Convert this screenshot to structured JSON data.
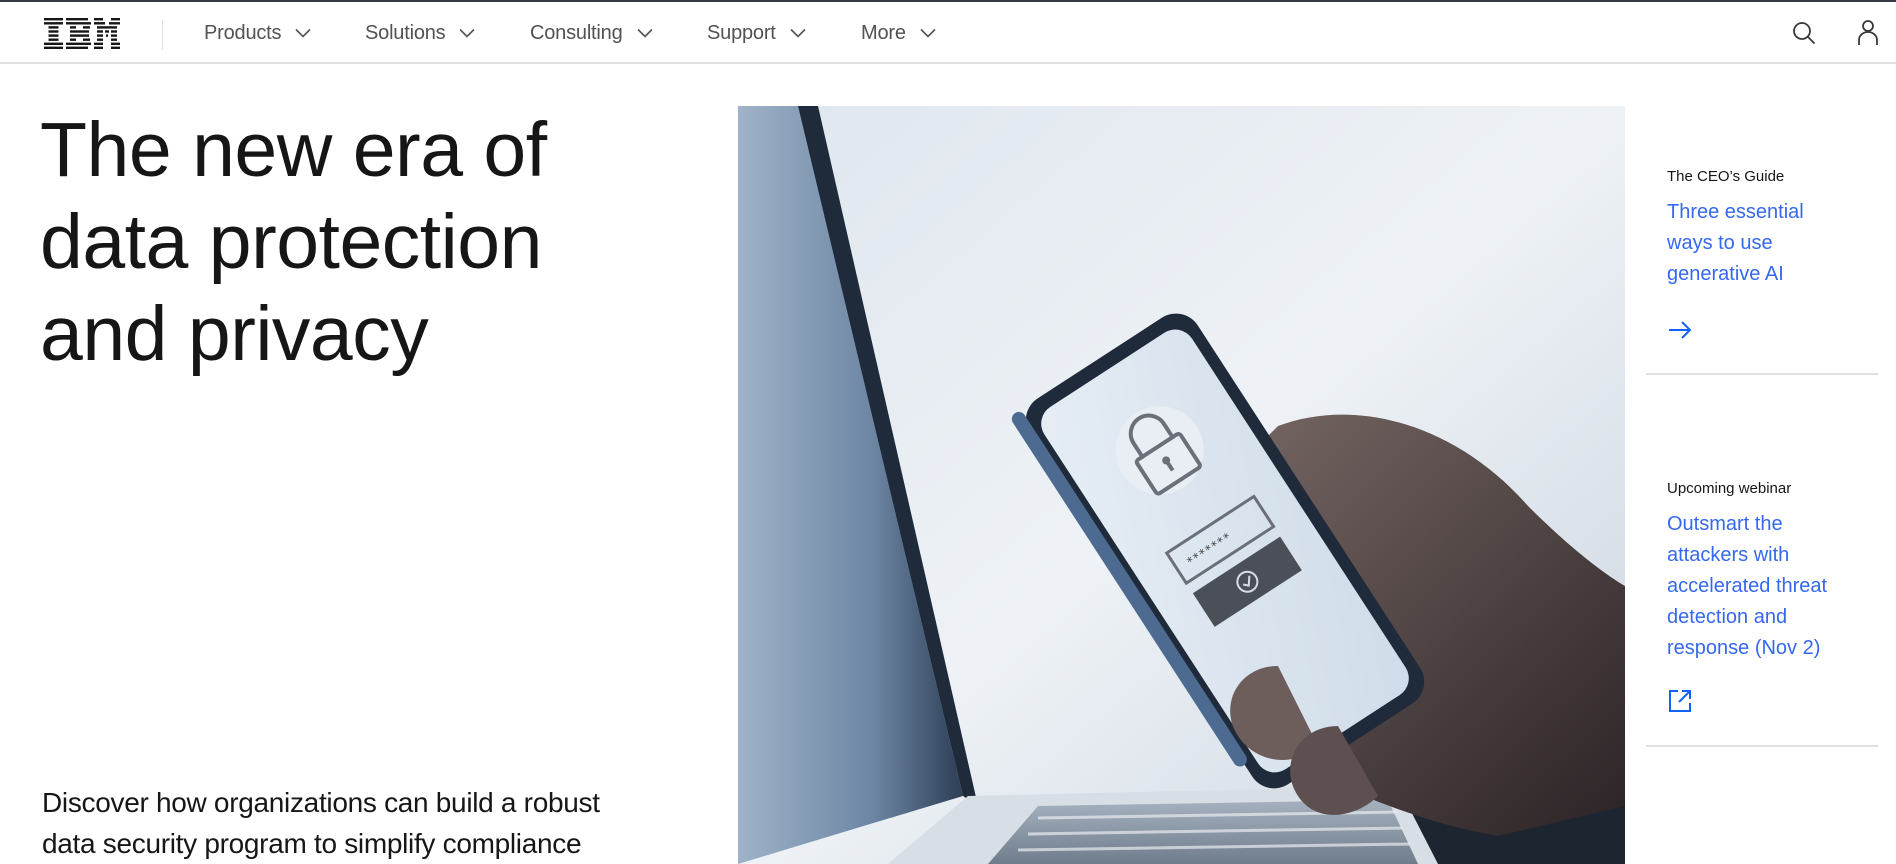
{
  "masthead": {
    "logo_alt": "IBM",
    "nav_items": [
      {
        "label": "Products",
        "icon": "chevron-down-icon"
      },
      {
        "label": "Solutions",
        "icon": "chevron-down-icon"
      },
      {
        "label": "Consulting",
        "icon": "chevron-down-icon"
      },
      {
        "label": "Support",
        "icon": "chevron-down-icon"
      },
      {
        "label": "More",
        "icon": "chevron-down-icon"
      }
    ],
    "actions": [
      {
        "name": "search",
        "icon": "search-icon"
      },
      {
        "name": "profile",
        "icon": "user-icon"
      }
    ]
  },
  "hero": {
    "headline_lines": [
      "The new era of",
      "data protection",
      "and privacy"
    ],
    "lede_lines": [
      "Discover how organizations can build a robust",
      "data security program to simplify compliance"
    ],
    "image_description": "Hand holding a smartphone showing a padlock and password login screen above a laptop keyboard"
  },
  "cards": [
    {
      "label": "The CEO’s Guide",
      "link_lines": [
        "Three essential",
        "ways to use",
        "generative AI"
      ],
      "icon": "arrow-right-icon"
    },
    {
      "label": "Upcoming webinar",
      "link_lines": [
        "Outsmart the",
        "attackers with",
        "accelerated threat",
        "detection and",
        "response (Nov 2)"
      ],
      "icon": "launch-icon"
    }
  ],
  "colors": {
    "link": "#0f62fe",
    "text": "#161616",
    "nav_text": "#525252",
    "border": "#e0e0e0",
    "top_bar": "#393a48"
  }
}
